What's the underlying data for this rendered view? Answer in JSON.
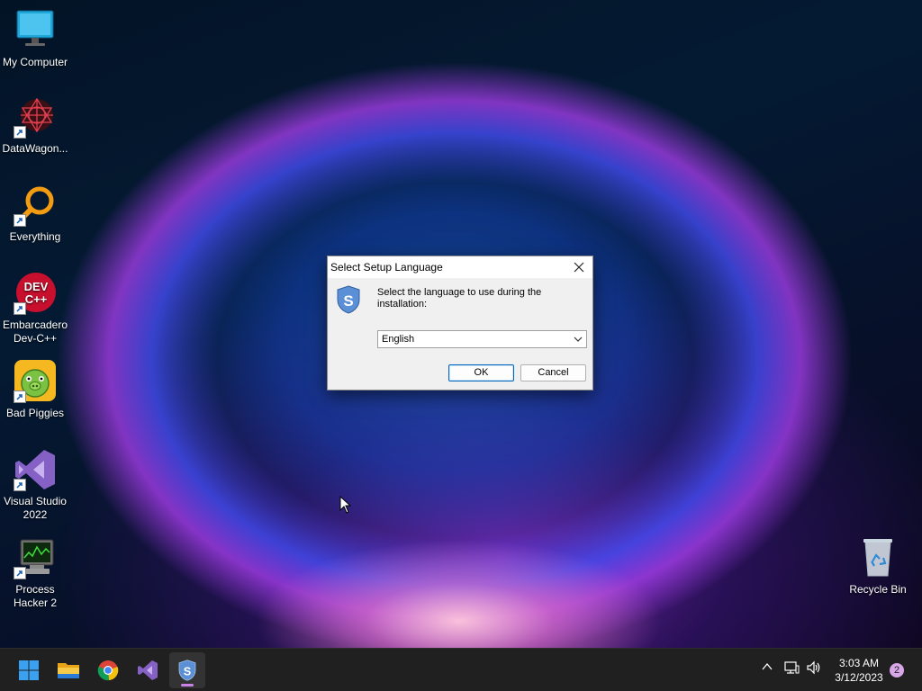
{
  "desktop": {
    "icons": [
      {
        "label": "My Computer"
      },
      {
        "label": "DataWagon..."
      },
      {
        "label": "Everything"
      },
      {
        "label_line1": "Embarcadero",
        "label_line2": "Dev-C++"
      },
      {
        "label": "Bad Piggies"
      },
      {
        "label_line1": "Visual Studio",
        "label_line2": "2022"
      },
      {
        "label_line1": "Process",
        "label_line2": "Hacker 2"
      },
      {
        "label": "Recycle Bin"
      }
    ]
  },
  "dialog": {
    "title": "Select Setup Language",
    "prompt": "Select the language to use during the installation:",
    "language_selected": "English",
    "ok_label": "OK",
    "cancel_label": "Cancel"
  },
  "taskbar": {
    "apps": [
      "start-icon",
      "file-explorer-icon",
      "chrome-icon",
      "visual-studio-icon",
      "setup-icon"
    ],
    "clock_time": "3:03 AM",
    "clock_date": "3/12/2023",
    "notification_count": "2"
  },
  "colors": {
    "taskbar_bg": "#202020",
    "dialog_bg": "#f0f0f0",
    "accent": "#0067c0"
  }
}
